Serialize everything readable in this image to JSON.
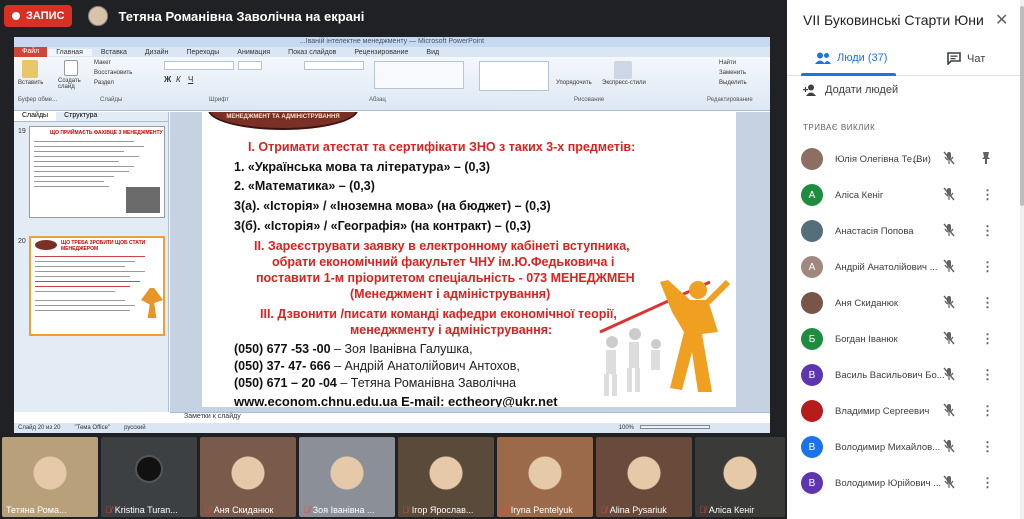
{
  "topbar": {
    "rec_label": "ЗАПИС",
    "presenter": "Тетяна Романівна Заволічна на екрані"
  },
  "ppt": {
    "window_title": "...Іваній інтелектне менеджменту — Microsoft PowerPoint",
    "tabs": [
      "Файл",
      "Главная",
      "Вставка",
      "Дизайн",
      "Переходы",
      "Анимация",
      "Показ слайдов",
      "Рецензирование",
      "Вид"
    ],
    "groups": [
      "Буфер обме...",
      "Слайды",
      "Шрифт",
      "Абзац",
      "Рисование",
      "Редактирование"
    ],
    "ribbon_buttons": {
      "paste": "Вставить",
      "create": "Создать слайд",
      "layout": "Макет",
      "reset": "Восстановить",
      "section": "Раздел",
      "arrange": "Упорядочить",
      "express": "Экспресс-стили",
      "find": "Найти",
      "replace": "Заменить",
      "select": "Выделить"
    },
    "left_tabs": [
      "Слайды",
      "Структура"
    ],
    "slide_numbers": [
      "19",
      "20"
    ],
    "thumb19_title": "ЩО ПРИЙМАЄТЬ ФАХІВЦЕ З МЕНЕДЖМЕНТУ",
    "thumb20_title": "ЩО ТРЕБА ЗРОБИТИ ЩОБ СТАТИ МЕНЕДЖЕРОМ",
    "notes": "Заметки к слайду",
    "status_slide": "Слайд 20 из 20",
    "status_theme": "\"Тема Office\"",
    "status_lang": "русский",
    "zoom": "100%"
  },
  "slide": {
    "logo": "МЕНЕДЖМЕНТ ТА АДМІНІСТРУВАННЯ",
    "l1": "І. Отримати атестат та сертифікати ЗНО з таких 3-х предметів:",
    "l2": "1.     «Українська мова та література» – (0,3)",
    "l3": "2.     «Математика» – (0,3)",
    "l4": "3(а). «Історія» / «Іноземна мова» (на бюджет) – (0,3)",
    "l5": "3(б). «Історія» / «Географія» (на контракт) – (0,3)",
    "l6": "ІІ. Зареєструвати заявку в електронному кабінеті вступника,",
    "l7": "обрати економічний факультет ЧНУ ім.Ю.Федьковича і",
    "l8": "поставити  1-м пріоритетом спеціальність  - 073 МЕНЕДЖМЕН",
    "l9": "(Менеджмент і адміністрування)",
    "l10": "ІІІ. Дзвонити /писати команді кафедри економічної теорії,",
    "l11": "менеджменту і адміністрування:",
    "phone1": "(050) 677 -53 -00",
    "name1": " – Зоя Іванівна Галушка,",
    "phone2": "(050) 37- 47- 666",
    "name2": " – Андрій Анатолійович Антохов,",
    "phone3": "(050) 671 – 20 -04",
    "name3": " – Тетяна Романівна Заволічна",
    "web": "www.econom.chnu.edu.ua  E-mail: ectheory@ukr.net"
  },
  "tiles": [
    {
      "name": "Тетяна Рома...",
      "muted": false,
      "bg": "#b8a07a"
    },
    {
      "name": "Kristina Turan...",
      "muted": true,
      "bg": "#3c4043"
    },
    {
      "name": "Аня Скиданюк",
      "muted": true,
      "bg": "#7a5a4a"
    },
    {
      "name": "Зоя Іванівна ...",
      "muted": true,
      "bg": "#8a8f98"
    },
    {
      "name": "Ігор Ярослав...",
      "muted": true,
      "bg": "#5a4a3a"
    },
    {
      "name": "Iryna Pentelyuk",
      "muted": true,
      "bg": "#9a6a4a"
    },
    {
      "name": "Alina Pysariuk",
      "muted": true,
      "bg": "#6a4a3a"
    },
    {
      "name": "Аліса Кеніг",
      "muted": true,
      "bg": "#3a3a38"
    }
  ],
  "side": {
    "title": "VII Буковинські Старти Юних Ек...",
    "people_tab": "Люди (37)",
    "chat_tab": "Чат",
    "add_people": "Додати людей",
    "section": "ТРИВАЄ ВИКЛИК",
    "you": "(Ви)",
    "participants": [
      {
        "name": "Юлія Олегівна Те...",
        "avatar": "",
        "color": "#8d6e63",
        "photo": true
      },
      {
        "name": "Аліса Кеніг",
        "avatar": "А",
        "color": "#1e8e3e",
        "photo": false
      },
      {
        "name": "Анастасія Попова",
        "avatar": "",
        "color": "#546e7a",
        "photo": true
      },
      {
        "name": "Андрій Анатолійович ...",
        "avatar": "А",
        "color": "#a1887f",
        "photo": false
      },
      {
        "name": "Аня Скиданюк",
        "avatar": "",
        "color": "#795548",
        "photo": true
      },
      {
        "name": "Богдан Іванюк",
        "avatar": "Б",
        "color": "#1e8e3e",
        "photo": false
      },
      {
        "name": "Василь Васильович Бо...",
        "avatar": "В",
        "color": "#5e35b1",
        "photo": false
      },
      {
        "name": "Владимир Сергеевич",
        "avatar": "",
        "color": "#b71c1c",
        "photo": true
      },
      {
        "name": "Володимир Михайлов...",
        "avatar": "В",
        "color": "#1a73e8",
        "photo": false
      },
      {
        "name": "Володимир Юрійович ...",
        "avatar": "В",
        "color": "#5e35b1",
        "photo": false
      }
    ]
  }
}
